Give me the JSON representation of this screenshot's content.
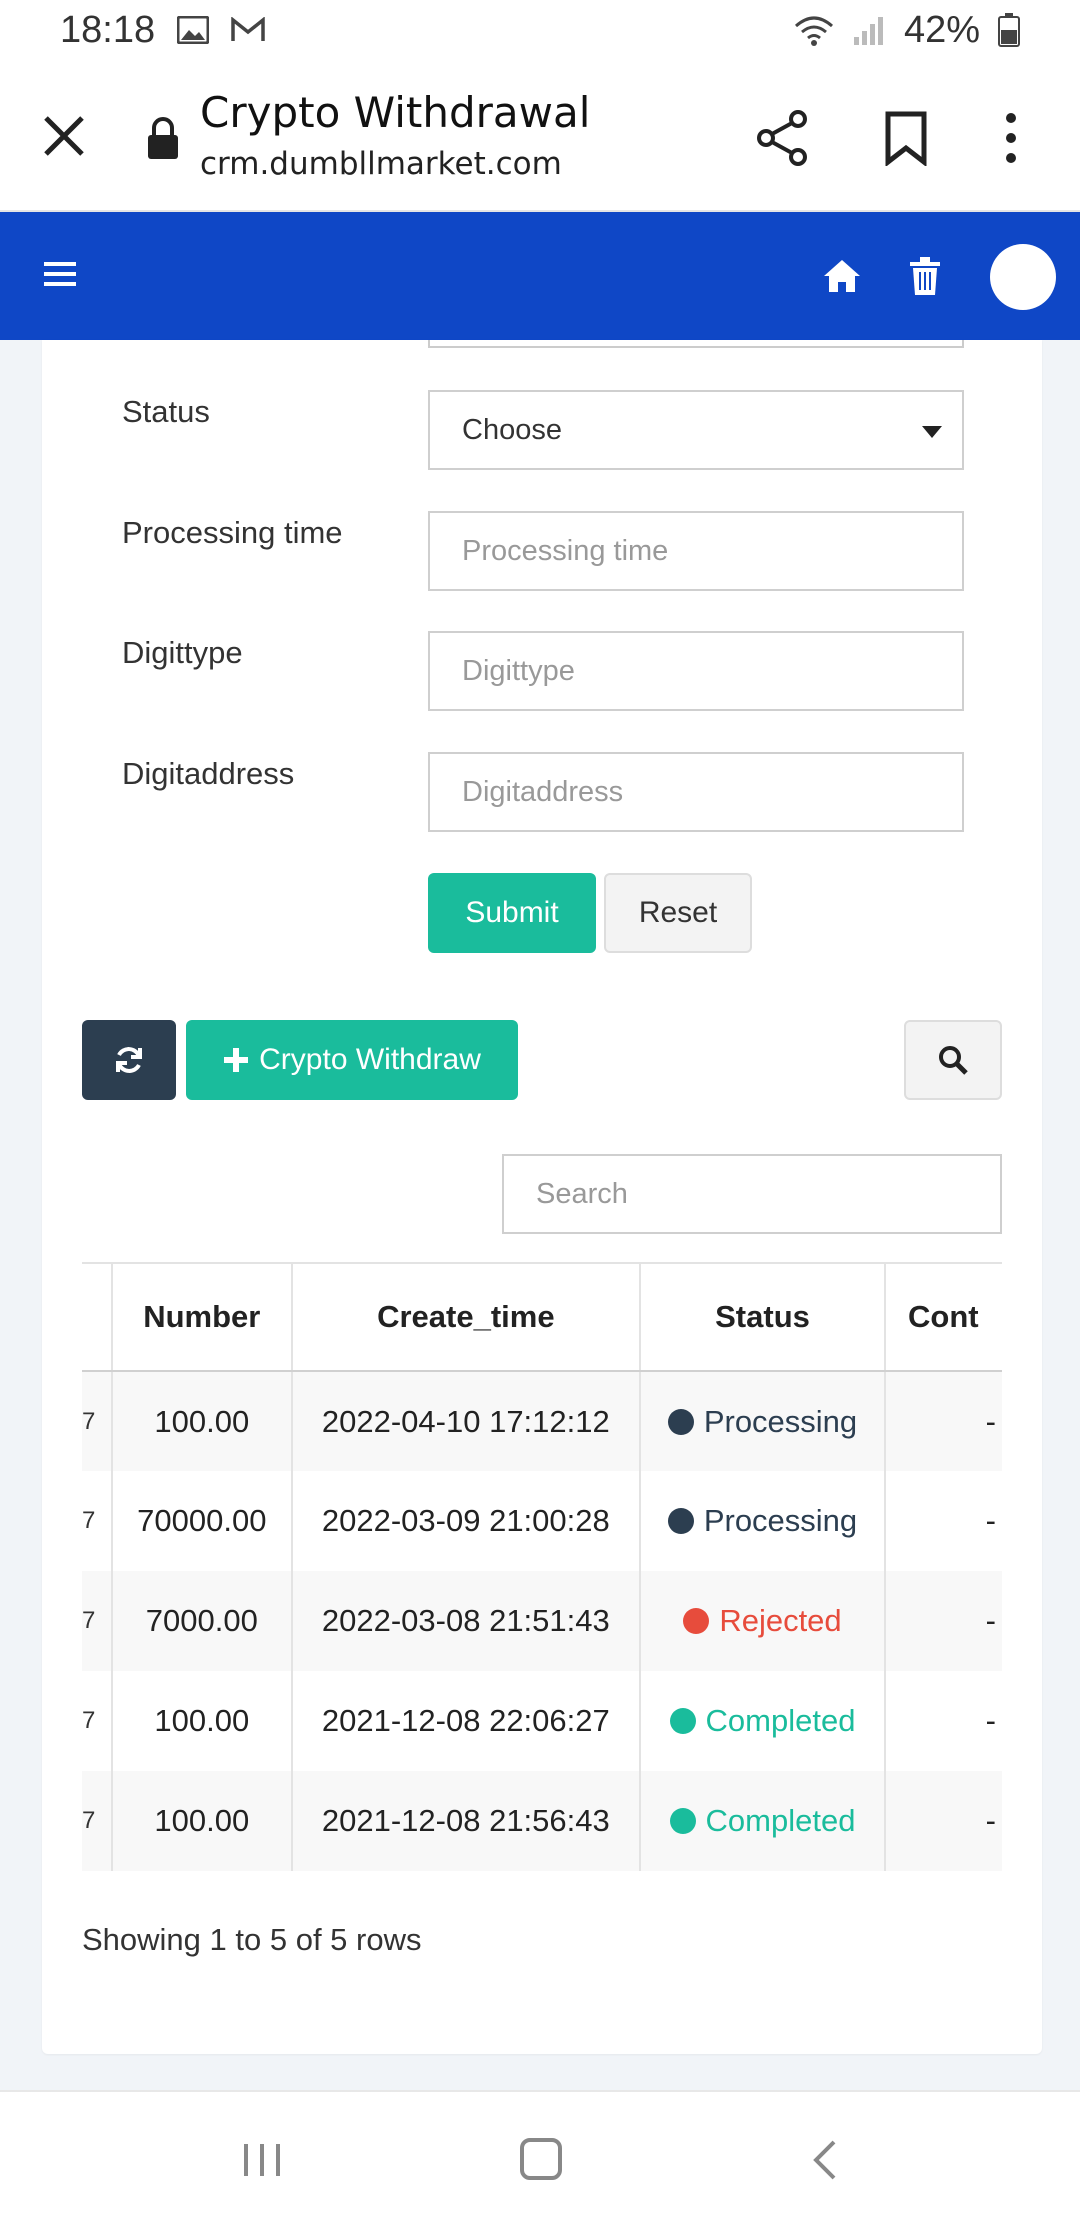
{
  "status_bar": {
    "time": "18:18",
    "battery": "42%",
    "icons": [
      "image-icon",
      "gmail-icon",
      "wifi-icon",
      "signal-icon",
      "battery-icon"
    ]
  },
  "browser": {
    "title": "Crypto Withdrawal",
    "url": "crm.dumbllmarket.com",
    "icons": [
      "close-icon",
      "lock-icon",
      "share-icon",
      "bookmark-icon",
      "more-icon"
    ]
  },
  "app_header": {
    "background": "#0f47c6",
    "icons": [
      "menu-icon",
      "home-icon",
      "trash-icon",
      "avatar"
    ]
  },
  "form": {
    "status_label": "Status",
    "status_value": "Choose",
    "processing_time_label": "Processing time",
    "processing_time_placeholder": "Processing time",
    "digittype_label": "Digittype",
    "digittype_placeholder": "Digittype",
    "digitaddress_label": "Digitaddress",
    "digitaddress_placeholder": "Digitaddress",
    "submit_label": "Submit",
    "reset_label": "Reset"
  },
  "toolbar": {
    "crypto_withdraw_label": "Crypto Withdraw",
    "search_placeholder": "Search"
  },
  "table": {
    "columns": [
      "Number",
      "Create_time",
      "Status",
      "Cont"
    ],
    "rows": [
      {
        "prefix": "7",
        "number": "100.00",
        "create_time": "2022-04-10 17:12:12",
        "status": "Processing",
        "status_color": "#2c3e50",
        "cont": "-"
      },
      {
        "prefix": "7",
        "number": "70000.00",
        "create_time": "2022-03-09 21:00:28",
        "status": "Processing",
        "status_color": "#2c3e50",
        "cont": "-"
      },
      {
        "prefix": "7",
        "number": "7000.00",
        "create_time": "2022-03-08 21:51:43",
        "status": "Rejected",
        "status_color": "#e74c3c",
        "cont": "-"
      },
      {
        "prefix": "7",
        "number": "100.00",
        "create_time": "2021-12-08 22:06:27",
        "status": "Completed",
        "status_color": "#1abc9c",
        "cont": "-"
      },
      {
        "prefix": "7",
        "number": "100.00",
        "create_time": "2021-12-08 21:56:43",
        "status": "Completed",
        "status_color": "#1abc9c",
        "cont": "-"
      }
    ]
  },
  "pagination": {
    "showing": "Showing 1 to 5 of 5 rows"
  },
  "colors": {
    "accent": "#1abc9c",
    "dark": "#2c3e50",
    "danger": "#e74c3c"
  }
}
